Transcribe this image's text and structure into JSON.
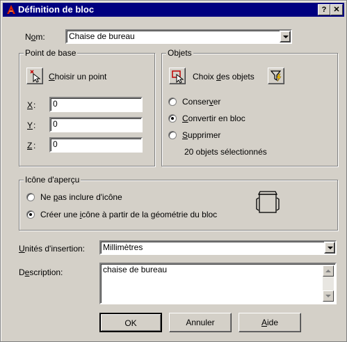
{
  "dialog": {
    "title": "Définition de bloc",
    "help_button": "?",
    "close_button": "✕"
  },
  "name": {
    "label_prefix": "N",
    "label_u": "o",
    "label_suffix": "m:",
    "value": "Chaise de bureau"
  },
  "base_point": {
    "title": "Point de base",
    "pick_label_u": "C",
    "pick_label_rest": "hoisir un point",
    "x_label": "X",
    "y_label": "Y",
    "z_label": "Z",
    "x_value": "0",
    "y_value": "0",
    "z_value": "0"
  },
  "objects": {
    "title": "Objets",
    "select_prefix": "Choix ",
    "select_u": "d",
    "select_suffix": "es objets",
    "options": [
      {
        "prefix": "Conser",
        "u": "v",
        "suffix": "er",
        "selected": false
      },
      {
        "prefix": "",
        "u": "C",
        "suffix": "onvertir en bloc",
        "selected": true
      },
      {
        "prefix": "",
        "u": "S",
        "suffix": "upprimer",
        "selected": false
      }
    ],
    "status": "20 objets sélectionnés"
  },
  "preview_icon": {
    "title": "Icône d'aperçu",
    "opt1_prefix": "Ne ",
    "opt1_u": "p",
    "opt1_suffix": "as inclure d'icône",
    "opt2_prefix": "Créer une ",
    "opt2_u": "i",
    "opt2_suffix": "cône à partir de la géométrie du bloc",
    "selected_index": 1
  },
  "insert_units": {
    "label_u": "U",
    "label_rest": "nités d'insertion:",
    "value": "Millimètres"
  },
  "description": {
    "label_prefix": "D",
    "label_u": "e",
    "label_suffix": "scription:",
    "value": "chaise de bureau"
  },
  "buttons": {
    "ok": "OK",
    "cancel": "Annuler",
    "help_u": "A",
    "help_rest": "ide"
  },
  "colors": {
    "title_bar": "#000080",
    "face": "#d4d0c8"
  }
}
